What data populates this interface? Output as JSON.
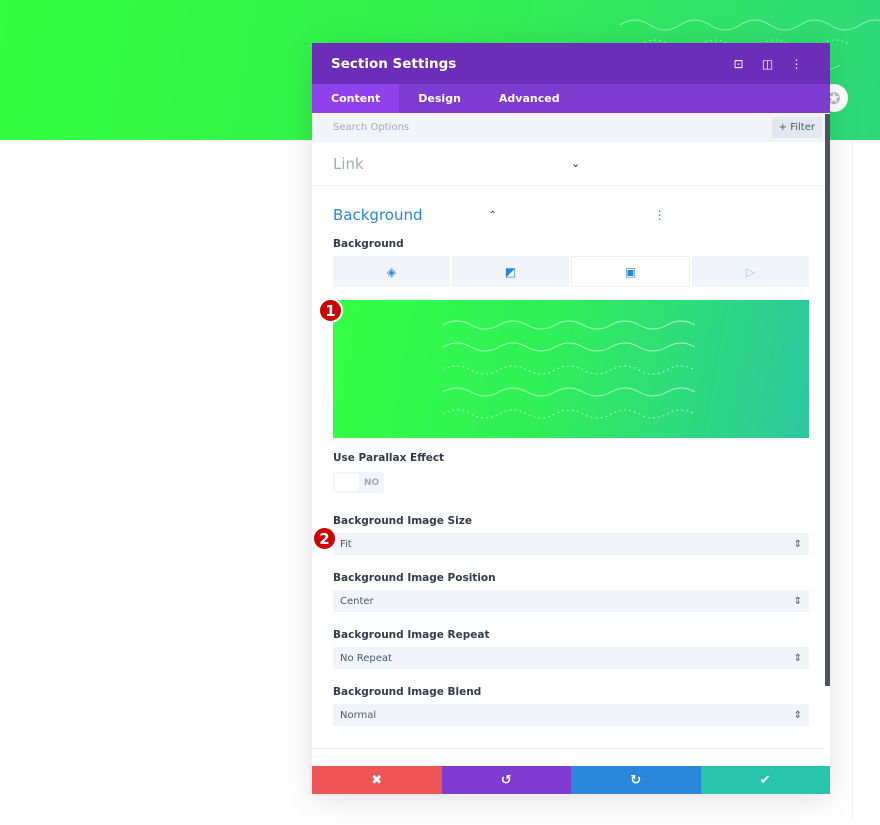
{
  "modal": {
    "title": "Section Settings",
    "header_icons": [
      "focus-icon",
      "split-view-icon",
      "more-vertical-icon"
    ]
  },
  "tabs": [
    {
      "label": "Content",
      "active": true
    },
    {
      "label": "Design"
    },
    {
      "label": "Advanced"
    }
  ],
  "search": {
    "placeholder": "Search Options",
    "filter_label": "+ Filter"
  },
  "sections": {
    "link": "Link",
    "background": "Background"
  },
  "background": {
    "label": "Background",
    "type_tabs": [
      "color-icon",
      "gradient-icon",
      "image-icon",
      "video-icon"
    ],
    "selected_type": "image",
    "parallax_label": "Use Parallax Effect",
    "parallax_value": "NO",
    "fields": [
      {
        "label": "Background Image Size",
        "value": "Fit"
      },
      {
        "label": "Background Image Position",
        "value": "Center"
      },
      {
        "label": "Background Image Repeat",
        "value": "No Repeat"
      },
      {
        "label": "Background Image Blend",
        "value": "Normal"
      }
    ]
  },
  "badges": [
    "1",
    "2"
  ],
  "footer": {
    "cancel": "✖",
    "undo": "↺",
    "redo": "↻",
    "save": "✔"
  },
  "colors": {
    "header": "#6c2eb9",
    "tabs": "#7e3bd0",
    "cancel": "#ef5555",
    "undo": "#7e3bd0",
    "redo": "#2b87da",
    "save": "#29c4a9"
  }
}
